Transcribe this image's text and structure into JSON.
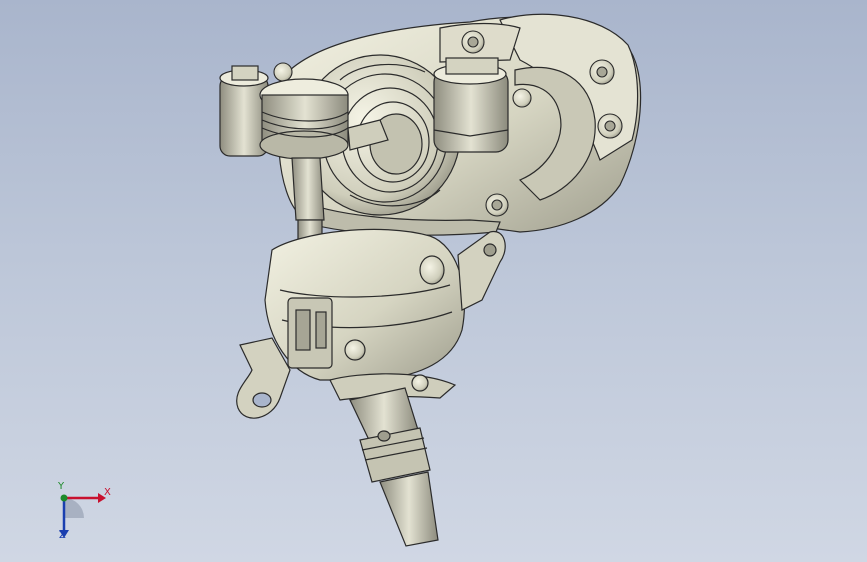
{
  "viewport": {
    "background_top": "#a9b5cc",
    "background_bottom": "#d0d7e4"
  },
  "model": {
    "body_color": "#d7d6c4",
    "edge_color": "#2b2b2b"
  },
  "triad": {
    "x_label": "X",
    "y_label": "Y",
    "z_label": "Z",
    "x_color": "#c8102e",
    "y_color": "#1d8a2a",
    "z_color": "#1a3fb0"
  }
}
